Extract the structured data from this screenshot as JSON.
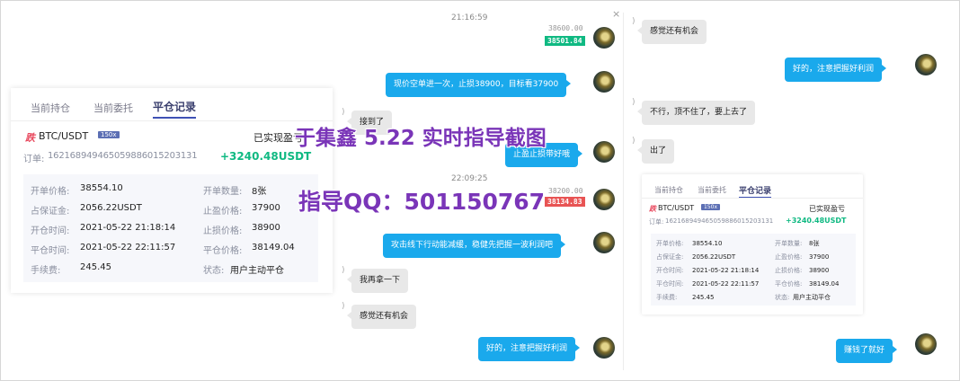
{
  "chat_left": {
    "timestamp1": "21:16:59",
    "timestamp2": "22:09:25",
    "price_tag1": {
      "prev": "38600.00",
      "current": "38501.84"
    },
    "price_tag2": {
      "prev": "38200.00",
      "current": "38134.83"
    },
    "msg_sent_1": "现价空单进一次，止损38900，目标看37900",
    "msg_recv_1": "接到了",
    "msg_sent_2": "止盈止损带好哦",
    "msg_sent_3": "攻击线下行动能减缓，稳健先把握一波利润吧",
    "msg_recv_2": "我再拿一下",
    "msg_recv_3": "感觉还有机会",
    "msg_sent_4": "好的，注意把握好利润"
  },
  "chat_right": {
    "msg_recv_1": "感觉还有机会",
    "msg_sent_1": "好的，注意把握好利润",
    "msg_recv_2": "不行，顶不住了，要上去了",
    "msg_recv_3": "出了",
    "msg_sent_2": "赚钱了就好"
  },
  "order_card": {
    "tabs": [
      "当前持仓",
      "当前委托",
      "平仓记录"
    ],
    "side_badge": "跌",
    "pair": "BTC/USDT",
    "leverage": "150x",
    "realized_label": "已实现盈亏",
    "order_label": "订单:",
    "order_id": "16216894946505988601520313​1",
    "pnl": "+3240.48USDT",
    "fields": {
      "open_price_label": "开单价格:",
      "open_price": "38554.10",
      "margin_label": "占保证金:",
      "margin": "2056.22USDT",
      "open_time_label": "开仓时间:",
      "open_time": "2021-05-22 21:18:14",
      "close_time_label": "平仓时间:",
      "close_time": "2021-05-22 22:11:57",
      "fee_label": "手续费:",
      "fee": "245.45",
      "qty_label": "开单数量:",
      "qty": "8张",
      "tp_label": "止盈价格:",
      "tp": "37900",
      "sl_label": "止损价格:",
      "sl": "38900",
      "close_price_label": "平仓价格:",
      "close_price": "38149.04",
      "status_label": "状态:",
      "status": "用户主动平仓"
    }
  },
  "watermark": {
    "line1": "于集鑫 5.22 实时指导截图",
    "line2": "指导QQ：501150767"
  },
  "colors": {
    "sent_bubble": "#1aa9ec",
    "recv_bubble": "#e8e8e8",
    "profit": "#0fb982",
    "loss_tag": "#e85454",
    "overlay_text": "#7a35b8"
  }
}
